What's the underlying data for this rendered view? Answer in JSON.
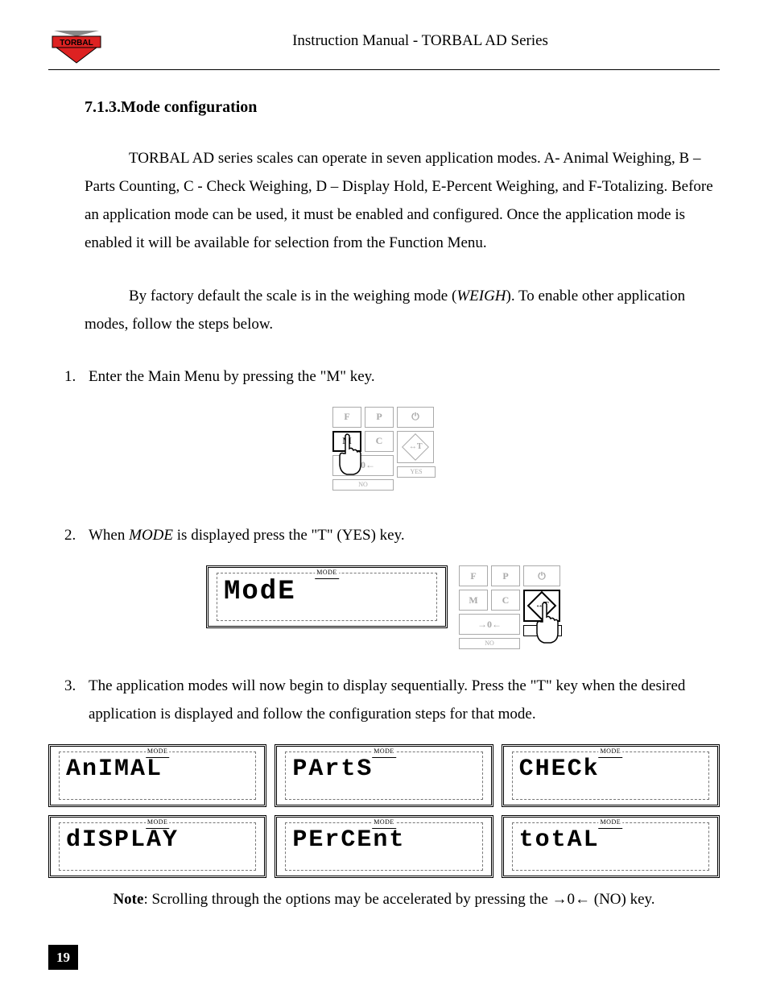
{
  "header": {
    "title": "Instruction Manual - TORBAL AD Series",
    "logo_text": "TORBAL"
  },
  "section": {
    "number": "7.1.3.",
    "title": "Mode configuration"
  },
  "paragraphs": {
    "p1": "TORBAL AD series scales can operate in seven application modes. A- Animal Weighing, B – Parts Counting, C - Check Weighing, D – Display Hold, E-Percent Weighing, and F-Totalizing. Before an application mode can be used, it must be enabled and configured. Once the application mode is enabled it will be available for selection from the Function Menu.",
    "p2_a": "By factory default the scale is in the weighing mode (",
    "p2_italic": "WEIGH",
    "p2_b": "). To enable other application modes, follow the steps below."
  },
  "steps": {
    "s1": {
      "num": "1.",
      "text": "Enter the Main Menu by pressing the \"M\" key."
    },
    "s2": {
      "num": "2.",
      "text_a": "When ",
      "text_italic": "MODE",
      "text_b": " is displayed press the \"T\" (YES) key."
    },
    "s3": {
      "num": "3.",
      "text": "The application modes will now begin to display sequentially. Press the \"T\" key when the desired application is displayed and follow the configuration steps for that mode."
    }
  },
  "keypad": {
    "F": "F",
    "P": "P",
    "M": "M",
    "C": "C",
    "T": "↔T",
    "zero": "→0←",
    "no": "NO",
    "yes": "YES",
    "power": "⏻",
    "print": "⎙"
  },
  "lcd": {
    "mode_tag": "MODE",
    "mode_big": "ModE",
    "modes": {
      "animal": "AnIMAL",
      "parts": "PArtS",
      "check": "CHECk",
      "display": "dISPLAY",
      "percent": "PErCEnt",
      "total": "totAL"
    }
  },
  "note": {
    "label": "Note",
    "text_a": ":  Scrolling through the options may be accelerated by pressing the ",
    "key": "→0←",
    "text_b": " (NO) key."
  },
  "page_number": "19"
}
